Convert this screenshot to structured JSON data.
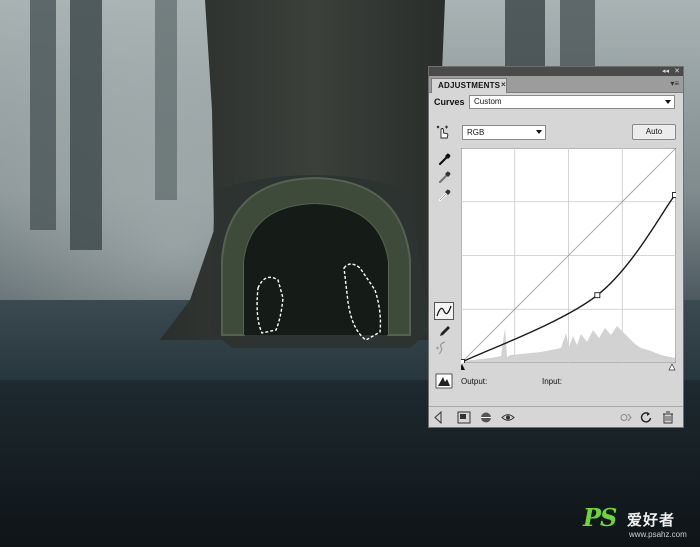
{
  "panel": {
    "tab_title": "ADJUSTMENTS",
    "tab_close_glyph": "×",
    "collapse_glyph": "◂◂",
    "close_glyph": "✕",
    "menu_glyph": "▾≡",
    "type_label": "Curves",
    "preset_value": "Custom",
    "channel_value": "RGB",
    "auto_label": "Auto",
    "output_label": "Output:",
    "input_label": "Input:"
  },
  "curve": {
    "input_range": [
      0,
      255
    ],
    "output_range": [
      0,
      255
    ],
    "points": [
      [
        0,
        0
      ],
      [
        162,
        80
      ],
      [
        255,
        200
      ]
    ],
    "grid_divisions": 4
  },
  "icons": {
    "on_image": "hand-finger-icon",
    "black_point": "black-eyedropper-icon",
    "gray_point": "gray-eyedropper-icon",
    "white_point": "white-eyedropper-icon",
    "point_edit": "curve-points-icon",
    "pencil": "pencil-icon",
    "smooth": "smooth-curve-icon",
    "clipping": "clipping-warning-icon"
  },
  "watermark": {
    "logo": "PS",
    "chinese": "爱好者",
    "url": "www.psahz.com"
  },
  "colors": {
    "panel_bg": "#d6d6d6",
    "graph_bg": "#ffffff",
    "histogram": "#cfcfcf",
    "curve": "#1a1a1a",
    "scene_dark": "#1c2428"
  }
}
